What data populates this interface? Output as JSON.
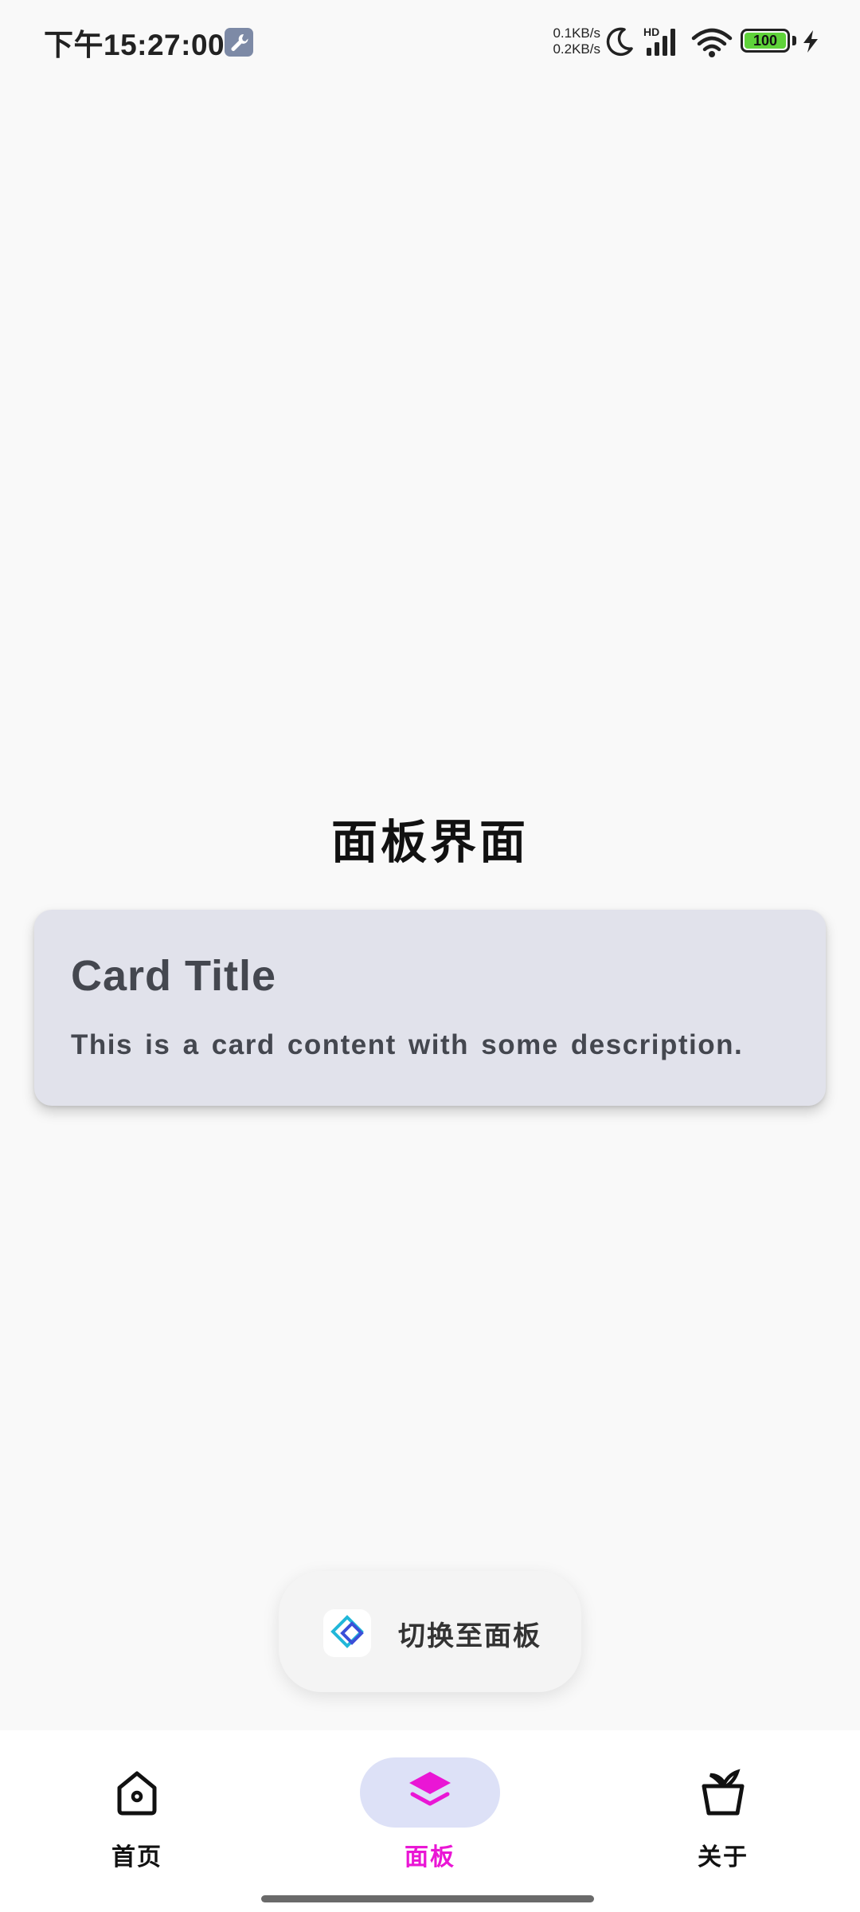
{
  "status_bar": {
    "time": "下午15:27:00",
    "net_up": "0.1KB/s",
    "net_down": "0.2KB/s",
    "network_type": "HD",
    "battery": "100",
    "battery_color": "#5fd33a"
  },
  "main": {
    "title": "面板界面",
    "card": {
      "title": "Card Title",
      "content": "This is a card content with some description.",
      "background": "#e1e2eb"
    }
  },
  "toast": {
    "icon": "app-logo-icon",
    "text": "切换至面板"
  },
  "bottom_nav": {
    "accent_color": "#ea16d5",
    "items": [
      {
        "label": "首页",
        "icon": "home-icon",
        "active": false
      },
      {
        "label": "面板",
        "icon": "layers-icon",
        "active": true
      },
      {
        "label": "关于",
        "icon": "basket-icon",
        "active": false
      }
    ]
  }
}
